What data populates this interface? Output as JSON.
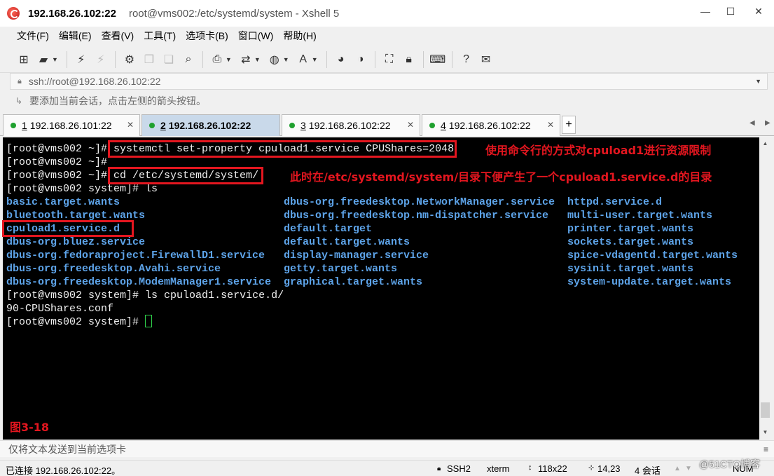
{
  "window": {
    "title_host": "192.168.26.102:22",
    "title_rest": "root@vms002:/etc/systemd/system - Xshell 5",
    "controls": {
      "minimize": "—",
      "maximize": "☐",
      "close": "✕"
    }
  },
  "menu": [
    "文件(F)",
    "编辑(E)",
    "查看(V)",
    "工具(T)",
    "选项卡(B)",
    "窗口(W)",
    "帮助(H)"
  ],
  "toolbar": {
    "icons": [
      "new-session-icon",
      "open-folder-icon",
      "connect-icon",
      "disconnect-icon",
      "properties-icon",
      "copy-icon",
      "paste-icon",
      "find-icon",
      "print-icon",
      "transfer-icon",
      "globe-icon",
      "font-icon",
      "xftp-icon",
      "xmanager-icon",
      "fullscreen-icon",
      "lock-icon",
      "keyboard-icon",
      "help-icon",
      "chat-icon"
    ]
  },
  "address": {
    "value": "ssh://root@192.168.26.102:22"
  },
  "session_hint": "要添加当前会话，点击左侧的箭头按钮。",
  "tabs": [
    {
      "num": "1",
      "label": "192.168.26.101:22",
      "active": false
    },
    {
      "num": "2",
      "label": "192.168.26.102:22",
      "active": true
    },
    {
      "num": "3",
      "label": "192.168.26.102:22",
      "active": false
    },
    {
      "num": "4",
      "label": "192.168.26.102:22",
      "active": false
    }
  ],
  "terminal": {
    "prompt_home": "[root@vms002 ~]#",
    "prompt_system": "[root@vms002 system]#",
    "cmd1": "systemctl set-property cpuload1.service CPUShares=2048",
    "cmd2": "cd /etc/systemd/system/",
    "cmd3": "ls",
    "cmd4": "ls cpuload1.service.d/",
    "out_conf": "90-CPUShares.conf",
    "ls_col1": [
      "basic.target.wants",
      "bluetooth.target.wants",
      "cpuload1.service.d",
      "dbus-org.bluez.service",
      "dbus-org.fedoraproject.FirewallD1.service",
      "dbus-org.freedesktop.Avahi.service",
      "dbus-org.freedesktop.ModemManager1.service"
    ],
    "ls_col2": [
      "dbus-org.freedesktop.NetworkManager.service",
      "dbus-org.freedesktop.nm-dispatcher.service",
      "default.target",
      "default.target.wants",
      "display-manager.service",
      "getty.target.wants",
      "graphical.target.wants"
    ],
    "ls_col3": [
      "httpd.service.d",
      "multi-user.target.wants",
      "printer.target.wants",
      "sockets.target.wants",
      "spice-vdagentd.target.wants",
      "sysinit.target.wants",
      "system-update.target.wants"
    ],
    "annot1": "使用命令行的方式对cpuload1进行资源限制",
    "annot2": "此时在/etc/systemd/system/目录下便产生了一个cpuload1.service.d的目录",
    "figure_label": "图3-18",
    "ls_color": "#5da3e8",
    "annot_color": "#e3161f"
  },
  "sendbar": {
    "text": "仅将文本发送到当前选项卡"
  },
  "status": {
    "connected": "已连接 192.168.26.102:22。",
    "protocol": "SSH2",
    "term": "xterm",
    "size": "118x22",
    "pos": "14,23",
    "sessions": "4 会话",
    "num": "NUM"
  },
  "watermark": "@51CTO博客"
}
